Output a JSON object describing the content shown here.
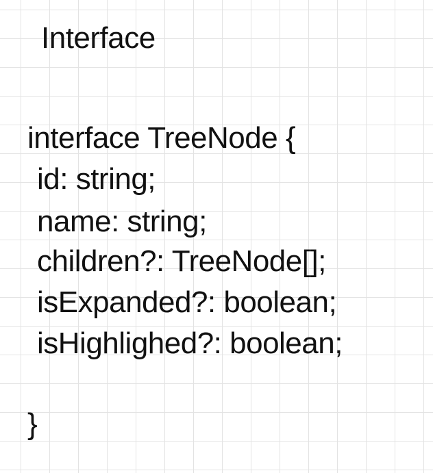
{
  "title": "Interface",
  "code": {
    "lines": [
      "interface TreeNode {",
      "id: string;",
      "name: string;",
      "children?: TreeNode[];",
      "isExpanded?: boolean;",
      "isHighlighed?: boolean;",
      "}"
    ]
  }
}
